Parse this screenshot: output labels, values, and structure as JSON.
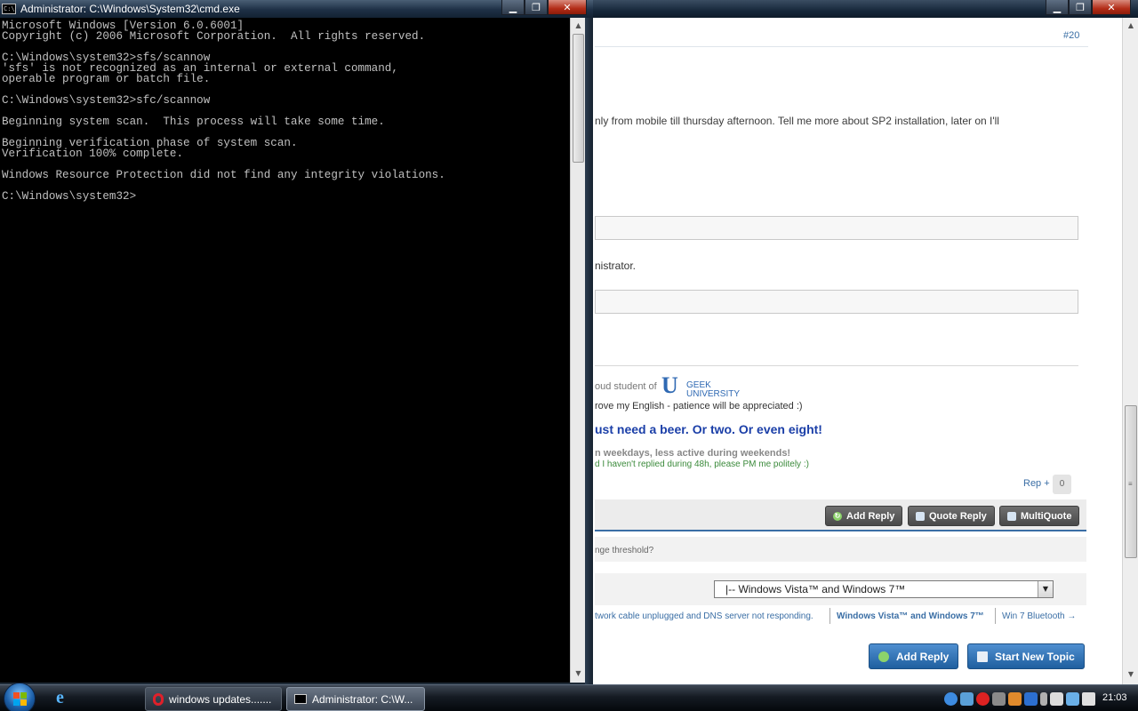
{
  "cmd": {
    "title": "Administrator: C:\\Windows\\System32\\cmd.exe",
    "icon_text": "C:\\",
    "output": "Microsoft Windows [Version 6.0.6001]\nCopyright (c) 2006 Microsoft Corporation.  All rights reserved.\n\nC:\\Windows\\system32>sfs/scannow\n'sfs' is not recognized as an internal or external command,\noperable program or batch file.\n\nC:\\Windows\\system32>sfc/scannow\n\nBeginning system scan.  This process will take some time.\n\nBeginning verification phase of system scan.\nVerification 100% complete.\n\nWindows Resource Protection did not find any integrity violations.\n\nC:\\Windows\\system32>"
  },
  "browser": {
    "post_number": "#20",
    "body_text": "nly from mobile till thursday afternoon. Tell me more about SP2 installation, later on I'll",
    "field_label": "nistrator.",
    "signature": {
      "line1": "oud student of",
      "logo_line1": "GEEK",
      "logo_line2": "UNIVERSITY",
      "line2": "rove my English - patience will be appreciated :)",
      "beer": "ust need a beer. Or two. Or even eight!",
      "line3": "n weekdays, less active during weekends!",
      "line4": "d I haven't replied during 48h, please PM me politely :)"
    },
    "rep": {
      "label": "Rep +",
      "count": "0"
    },
    "actions": {
      "add_reply": "Add Reply",
      "quote_reply": "Quote Reply",
      "multiquote": "MultiQuote"
    },
    "threshold_text": "nge threshold?",
    "jump_select": "|-- Windows Vista™ and Windows 7™",
    "links": {
      "prev": "twork cable unplugged and DNS server not responding.",
      "forum": "Windows Vista™ and Windows 7™",
      "next": "Win 7 Bluetooth →"
    },
    "bottom": {
      "add_reply": "Add Reply",
      "new_topic": "Start New Topic"
    }
  },
  "window_buttons": {
    "minimize": "▁",
    "maximize": "❐",
    "close": "✕"
  },
  "taskbar": {
    "tasks": [
      {
        "label": "windows updates......."
      },
      {
        "label": "Administrator: C:\\W..."
      }
    ],
    "clock": "21:03"
  },
  "colors": {
    "console_bg": "#000000",
    "console_text": "#c0c0c0",
    "link_blue": "#3a6ea5",
    "beer_blue": "#1b3fa8"
  }
}
